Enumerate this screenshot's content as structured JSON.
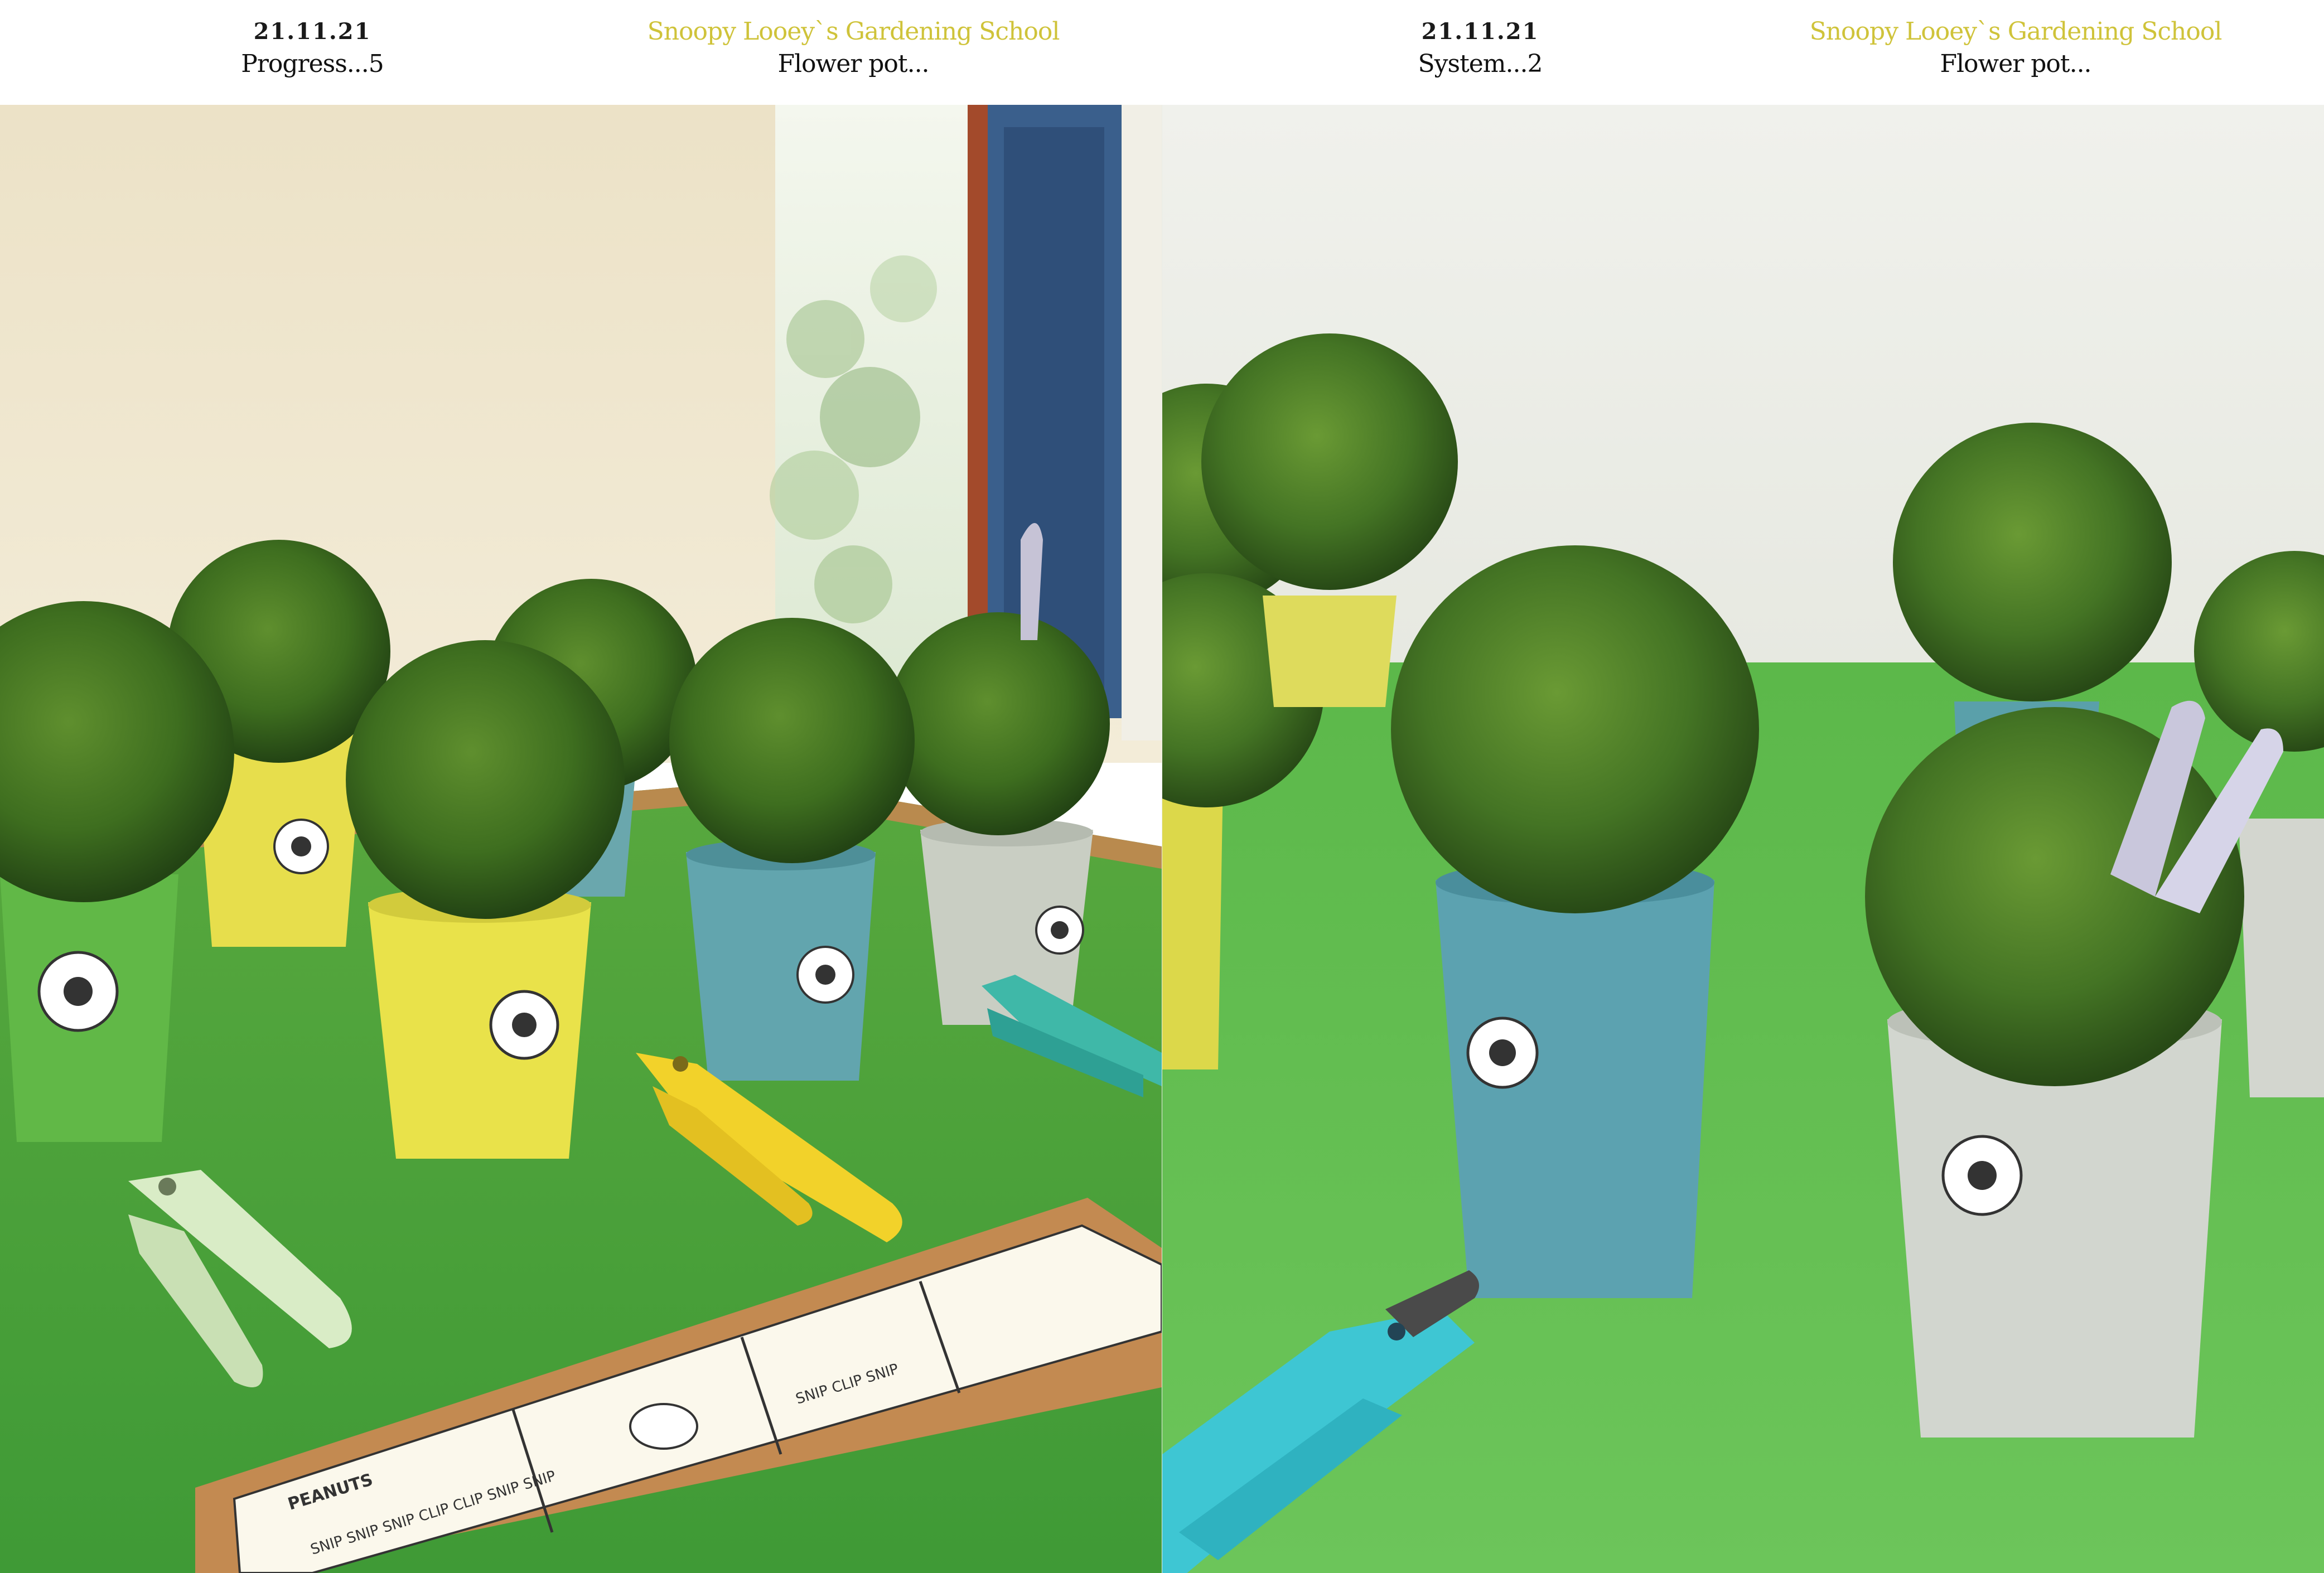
{
  "left_page": {
    "date": "21.11.21",
    "subtitle": "Progress...5",
    "school": "Snoopy Looey`s Gardening School",
    "caption": "Flower pot..."
  },
  "right_page": {
    "date": "21.11.21",
    "subtitle": "System...2",
    "school": "Snoopy Looey`s Gardening School",
    "caption": "Flower pot..."
  },
  "colors": {
    "school_text": "#cfc33a",
    "table_green": "#4fa33a",
    "wall": "#eee6cf",
    "pot_yellow": "#e8e04a",
    "pot_blue": "#5ea7b3",
    "pot_grey": "#c8cec6",
    "pruner_yellow": "#f2d22a",
    "pruner_teal": "#3fb8a8",
    "pruner_mint": "#d8ecc6",
    "pruner_aqua": "#3ec6d3"
  },
  "comic": {
    "brand": "PEANUTS",
    "panel1_text": "SNIP SNIP SNIP CLIP CLIP SNIP SNIP",
    "panel3_text": "SNIP CLIP SNIP"
  }
}
